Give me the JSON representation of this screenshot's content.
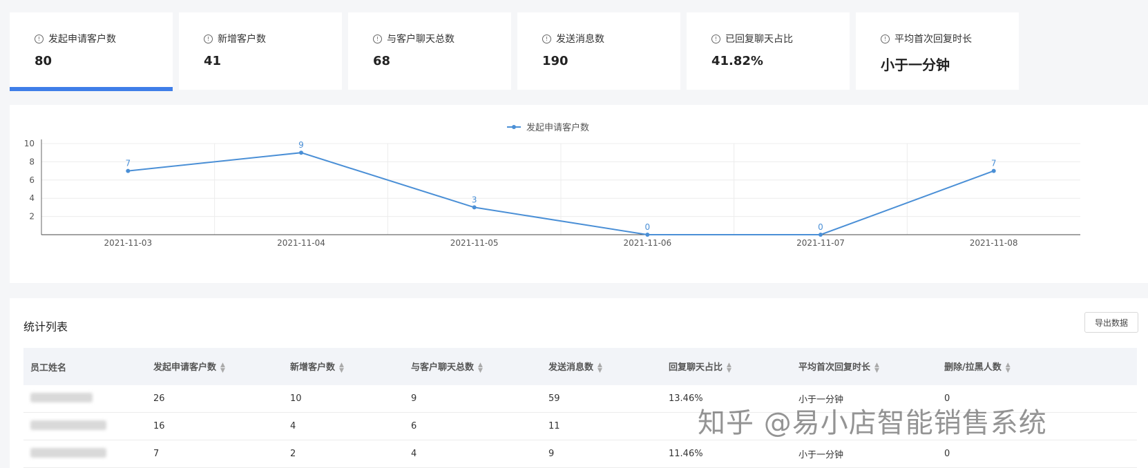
{
  "stats": [
    {
      "label": "发起申请客户数",
      "value": "80",
      "active": true
    },
    {
      "label": "新增客户数",
      "value": "41"
    },
    {
      "label": "与客户聊天总数",
      "value": "68"
    },
    {
      "label": "发送消息数",
      "value": "190"
    },
    {
      "label": "已回复聊天占比",
      "value": "41.82%"
    },
    {
      "label": "平均首次回复时长",
      "value": "小于一分钟"
    }
  ],
  "chart_data": {
    "type": "line",
    "categories": [
      "2021-11-03",
      "2021-11-04",
      "2021-11-05",
      "2021-11-06",
      "2021-11-07",
      "2021-11-08"
    ],
    "series": [
      {
        "name": "发起申请客户数",
        "values": [
          7,
          9,
          3,
          0,
          0,
          7
        ]
      }
    ],
    "yticks": [
      "2",
      "4",
      "6",
      "8",
      "10"
    ],
    "ylim": [
      0,
      10
    ],
    "legend": "top-center",
    "grid": true,
    "color": "#4a8fd6"
  },
  "table": {
    "title": "统计列表",
    "export_label": "导出数据",
    "headers": [
      "员工姓名",
      "发起申请客户数",
      "新增客户数",
      "与客户聊天总数",
      "发送消息数",
      "回复聊天占比",
      "平均首次回复时长",
      "删除/拉黑人数"
    ],
    "rows": [
      [
        "",
        "26",
        "10",
        "9",
        "59",
        "13.46%",
        "小于一分钟",
        "0"
      ],
      [
        "",
        "16",
        "4",
        "6",
        "11",
        "",
        "",
        ""
      ],
      [
        "",
        "7",
        "2",
        "4",
        "9",
        "11.46%",
        "小于一分钟",
        "0"
      ]
    ]
  },
  "watermark": "知乎 @易小店智能销售系统"
}
